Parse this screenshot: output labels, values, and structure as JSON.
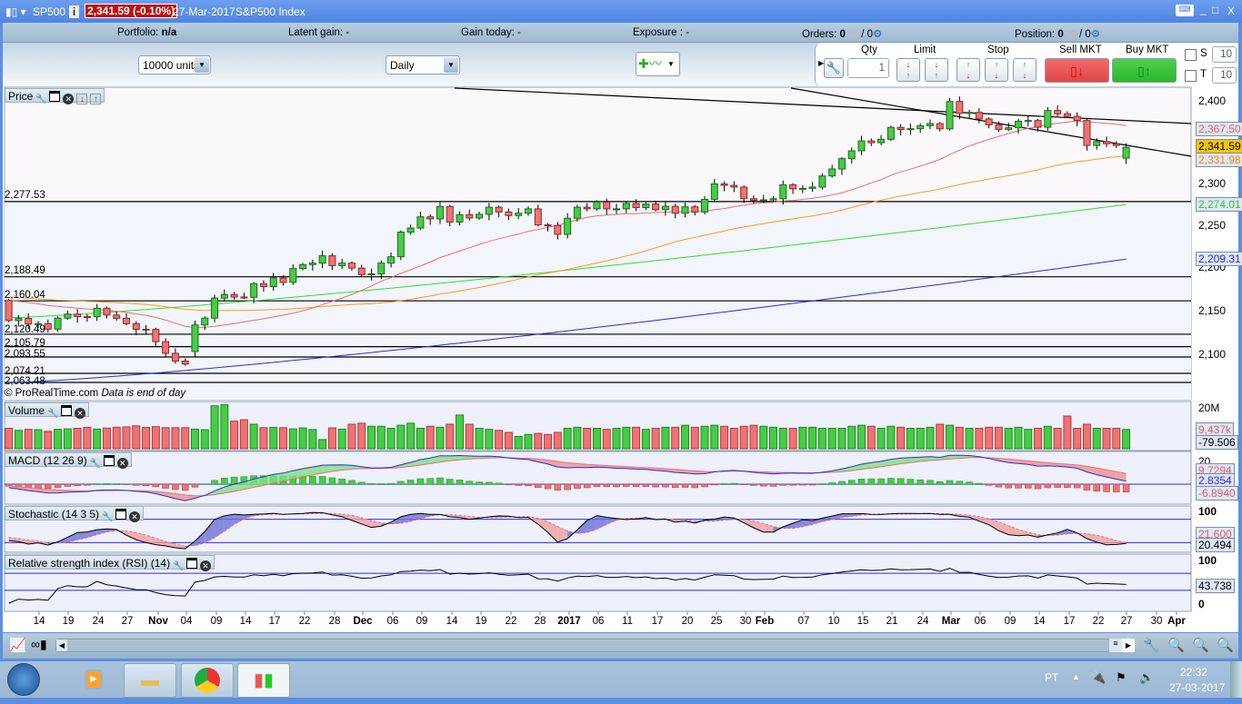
{
  "titlebar": {
    "symbol": "SP500",
    "price_badge": "2,341.59 (-0.10%)",
    "date": "27-Mar-2017",
    "instrument_name": "S&P500 Index",
    "minimize": "_",
    "maximize": "□",
    "close": "X"
  },
  "infobar": {
    "portfolio_label": "Portfolio:",
    "portfolio_value": "n/a",
    "latent_label": "Latent gain:",
    "latent_value": "-",
    "gain_today_label": "Gain today:",
    "gain_today_value": "-",
    "exposure_label": "Exposure :",
    "exposure_value": "-",
    "orders_label": "Orders:",
    "orders_value": "0",
    "orders_total": "/ 0",
    "position_label": "Position:",
    "position_value": "0",
    "position_total": "/ 0"
  },
  "toolbar": {
    "units": "10000 units",
    "timeframe": "Daily"
  },
  "orders": {
    "qty_label": "Qty",
    "qty_value": "1",
    "limit_label": "Limit",
    "stop_label": "Stop",
    "sell_label": "Sell MKT",
    "buy_label": "Buy MKT",
    "s_label": "S",
    "s_value": "10",
    "t_label": "T",
    "t_value": "10"
  },
  "panels": {
    "price": "Price",
    "volume": "Volume",
    "macd": "MACD (12 26 9)",
    "stochastic": "Stochastic (14 3 5)",
    "rsi": "Relative strength index (RSI) (14)"
  },
  "copyright": "© ProRealTime.com",
  "data_note": "Data is end of day",
  "price_axis": {
    "ticks": [
      "2,400",
      "2,300",
      "2,250",
      "2,200",
      "2,150",
      "2,100"
    ],
    "ma20": "2,367.50",
    "last": "2,341.59",
    "ma50": "2,331.98",
    "ma100": "2,274.01",
    "ma200": "2,209.31"
  },
  "volume_axis": {
    "top": "20M",
    "last": "9,437k",
    "osc": "-79.506"
  },
  "macd_axis": {
    "top": "20",
    "signal": "9.7294",
    "macd": "2.8354",
    "hist": "-6.8940"
  },
  "stoch_axis": {
    "top": "100",
    "d": "21.600",
    "k": "20.494"
  },
  "rsi_axis": {
    "top": "100",
    "last": "43.738",
    "bottom": "0"
  },
  "levels": [
    "2,277.53",
    "2,188.49",
    "2,160.04",
    "2,120.49",
    "2,105.79",
    "2,093.55",
    "2,074.21",
    "2,063.48"
  ],
  "date_labels": [
    {
      "t": "14"
    },
    {
      "t": "19"
    },
    {
      "t": "24"
    },
    {
      "t": "27"
    },
    {
      "t": "Nov",
      "b": 1
    },
    {
      "t": "04"
    },
    {
      "t": "09"
    },
    {
      "t": "14"
    },
    {
      "t": "17"
    },
    {
      "t": "22"
    },
    {
      "t": "28"
    },
    {
      "t": "Dec",
      "b": 1
    },
    {
      "t": "06"
    },
    {
      "t": "09"
    },
    {
      "t": "14"
    },
    {
      "t": "19"
    },
    {
      "t": "22"
    },
    {
      "t": "28"
    },
    {
      "t": "2017",
      "b": 1
    },
    {
      "t": "06"
    },
    {
      "t": "11"
    },
    {
      "t": "17"
    },
    {
      "t": "20"
    },
    {
      "t": "25"
    },
    {
      "t": "30"
    },
    {
      "t": "Feb",
      "b": 1
    },
    {
      "t": "07"
    },
    {
      "t": "10"
    },
    {
      "t": "15"
    },
    {
      "t": "21"
    },
    {
      "t": "24"
    },
    {
      "t": "Mar",
      "b": 1
    },
    {
      "t": "06"
    },
    {
      "t": "09"
    },
    {
      "t": "14"
    },
    {
      "t": "17"
    },
    {
      "t": "22"
    },
    {
      "t": "27"
    },
    {
      "t": "30"
    },
    {
      "t": "Apr",
      "b": 1
    }
  ],
  "taskbar": {
    "lang": "PT",
    "time": "22:32",
    "date": "27-03-2017"
  },
  "colors": {
    "up": "#46cc46",
    "down": "#f07272",
    "ma20": "#e87070",
    "ma50": "#ff9a1a",
    "ma100": "#33dd33",
    "ma200": "#2b2bdd",
    "badge": "#c01010"
  },
  "chart_data": {
    "type": "candlestick",
    "start": "2016-10-11",
    "end": "2017-03-27",
    "closes": [
      2136.7,
      2139.2,
      2132.6,
      2133.0,
      2126.5,
      2139.6,
      2144.3,
      2141.3,
      2141.2,
      2151.3,
      2143.2,
      2139.4,
      2133.0,
      2126.4,
      2126.2,
      2111.7,
      2097.9,
      2088.7,
      2085.2,
      2131.5,
      2139.6,
      2163.3,
      2167.5,
      2164.5,
      2164.2,
      2180.4,
      2176.9,
      2187.1,
      2181.9,
      2198.2,
      2202.9,
      2204.7,
      2213.4,
      2201.7,
      2204.7,
      2198.8,
      2191.1,
      2192.0,
      2204.7,
      2212.2,
      2241.4,
      2246.2,
      2259.5,
      2257.0,
      2271.7,
      2253.3,
      2262.0,
      2258.1,
      2262.5,
      2270.8,
      2265.2,
      2261.0,
      2263.8,
      2268.9,
      2249.9,
      2249.3,
      2238.8,
      2257.8,
      2270.8,
      2269.0,
      2277.0,
      2268.9,
      2268.9,
      2275.3,
      2270.4,
      2274.6,
      2267.9,
      2271.9,
      2263.7,
      2271.3,
      2265.2,
      2280.1,
      2298.4,
      2296.7,
      2294.7,
      2280.9,
      2278.9,
      2279.6,
      2280.9,
      2297.4,
      2292.6,
      2293.1,
      2294.7,
      2307.9,
      2316.1,
      2328.3,
      2337.6,
      2349.3,
      2347.2,
      2351.2,
      2365.4,
      2362.8,
      2363.8,
      2367.3,
      2369.8,
      2363.6,
      2396.0,
      2381.9,
      2383.1,
      2375.3,
      2368.4,
      2363.0,
      2364.9,
      2372.6,
      2373.5,
      2365.5,
      2385.3,
      2381.4,
      2378.3,
      2373.5,
      2344.0,
      2348.5,
      2346.0,
      2344.0,
      2341.59
    ],
    "open_overrides": {
      "0": 2160.5,
      "19": 2100.0,
      "114": 2329.0
    },
    "volume_millions": [
      10,
      9,
      9.5,
      9.3,
      8.5,
      9.5,
      9.7,
      10,
      10.5,
      9.6,
      10.1,
      10.5,
      10.7,
      11.2,
      10.4,
      10.8,
      10.3,
      10.3,
      10.3,
      9.6,
      9.3,
      21,
      21.5,
      13.5,
      14.2,
      12,
      10.3,
      10.4,
      10.3,
      9.7,
      10.2,
      9.4,
      4.5,
      10.2,
      9.6,
      12,
      12.5,
      11,
      11,
      10,
      11.5,
      12.5,
      10,
      11,
      10.5,
      12,
      16.5,
      12,
      10,
      9.5,
      9,
      8,
      6,
      7,
      7.5,
      7,
      8,
      10,
      10.5,
      10,
      10,
      9.5,
      10,
      10.5,
      10.5,
      9.5,
      10,
      10.5,
      10.5,
      11.5,
      10.5,
      11,
      11.5,
      11,
      10,
      11,
      11.5,
      11,
      10.5,
      10,
      10,
      10.5,
      10.5,
      10,
      10,
      10,
      11,
      11.5,
      11,
      10,
      11,
      10.5,
      10,
      10,
      10.5,
      12,
      11.5,
      10.5,
      10,
      10,
      10.5,
      10.5,
      10,
      10.5,
      9.5,
      10,
      11,
      10,
      16,
      10,
      12,
      10,
      10,
      10,
      9.437
    ],
    "moving_averages": {
      "ma100": {
        "start": 2140,
        "end": 2274.01
      },
      "ma200": {
        "start": 2063,
        "end": 2209.31
      }
    },
    "indicators": [
      "Volume",
      "MACD (12 26 9)",
      "Stochastic (14 3 5)",
      "RSI (14)"
    ],
    "ylim": [
      2055,
      2410
    ]
  }
}
